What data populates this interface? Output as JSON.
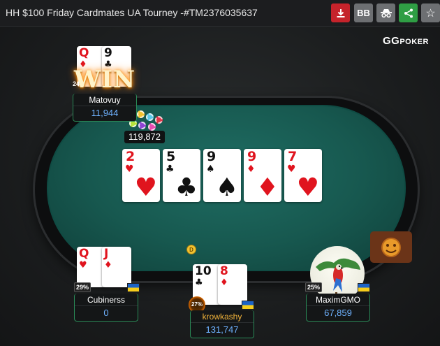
{
  "header": {
    "title": "HH $100 Friday Cardmates UA Tourney -#TM2376035637",
    "buttons": {
      "bb_label": "BB"
    },
    "brand": {
      "gg": "GG",
      "poker": "POKER"
    }
  },
  "colors": {
    "felt": "#17584f",
    "stack_blue": "#6fb2ff",
    "accent_green": "#2a8a57",
    "download_red": "#c5232b",
    "share_green": "#2f9e44"
  },
  "board": [
    {
      "rank": "2",
      "suit": "♥",
      "color": "red"
    },
    {
      "rank": "5",
      "suit": "♣",
      "color": "black"
    },
    {
      "rank": "9",
      "suit": "♠",
      "color": "black"
    },
    {
      "rank": "9",
      "suit": "♦",
      "color": "red"
    },
    {
      "rank": "7",
      "suit": "♥",
      "color": "red"
    }
  ],
  "pot": "119,872",
  "players": {
    "top": {
      "name": "Matovuy",
      "stack": "11,944",
      "badge": "WIN",
      "badge_number": "24",
      "cards": [
        {
          "rank": "Q",
          "suit": "♦",
          "color": "red"
        },
        {
          "rank": "9",
          "suit": "♣",
          "color": "black"
        }
      ]
    },
    "bottom_left": {
      "name": "Cubinerss",
      "stack": "0",
      "percent": "29%",
      "cards": [
        {
          "rank": "Q",
          "suit": "♥",
          "color": "red"
        },
        {
          "rank": "J",
          "suit": "♦",
          "color": "red"
        }
      ]
    },
    "bottom_center": {
      "name": "krowkashy",
      "stack": "131,747",
      "percent": "27%",
      "cards": [
        {
          "rank": "10",
          "suit": "♣",
          "color": "black"
        },
        {
          "rank": "8",
          "suit": "♦",
          "color": "red"
        }
      ]
    },
    "bottom_right": {
      "name": "MaximGMO",
      "stack": "67,859",
      "percent": "25%"
    }
  },
  "dealer_button": "D"
}
